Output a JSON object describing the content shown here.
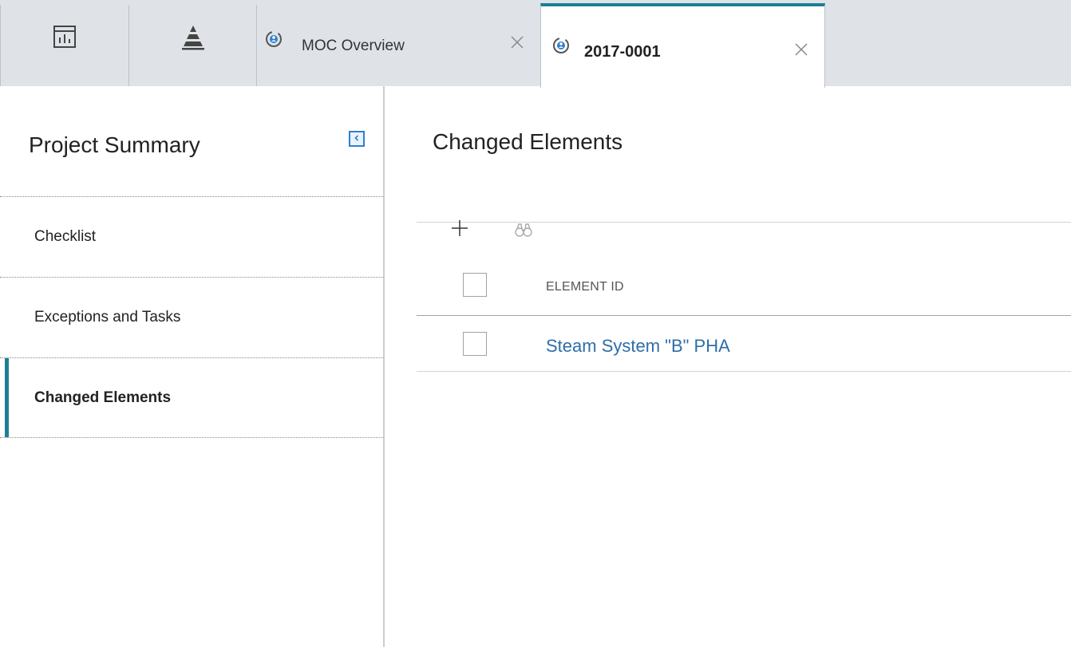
{
  "tabs": {
    "icon_tabs": [
      {
        "icon": "dashboard-chart-icon"
      },
      {
        "icon": "pyramid-icon"
      }
    ],
    "doc_tabs": [
      {
        "label": "MOC Overview",
        "icon": "moc-cycle-icon",
        "active": false
      },
      {
        "label": "2017-0001",
        "icon": "moc-cycle-icon",
        "active": true
      }
    ]
  },
  "sidebar": {
    "title": "Project Summary",
    "items": [
      {
        "label": "Checklist",
        "active": false
      },
      {
        "label": "Exceptions and Tasks",
        "active": false
      },
      {
        "label": "Changed Elements",
        "active": true
      }
    ]
  },
  "main": {
    "title": "Changed Elements",
    "table": {
      "columns": [
        "ELEMENT ID"
      ],
      "rows": [
        {
          "element_id": "Steam System \"B\" PHA"
        }
      ]
    }
  },
  "colors": {
    "accent": "#1b7f94",
    "link": "#2d6ea8",
    "tabbar": "#dfe3e8",
    "collapse": "#2f7fd1"
  }
}
